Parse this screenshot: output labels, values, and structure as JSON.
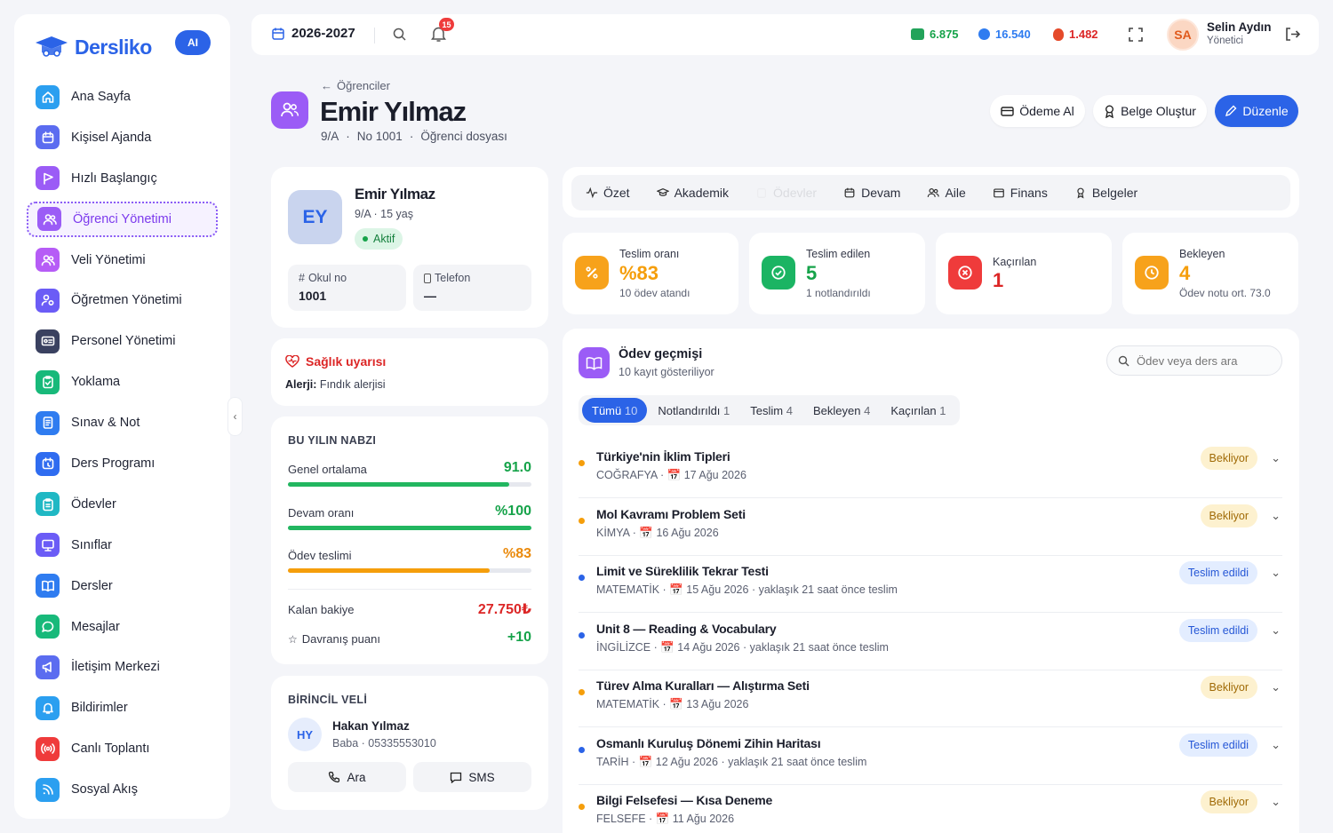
{
  "sidebar": {
    "brand": "Dersliko",
    "ai_badge": "AI",
    "items": [
      {
        "label": "Ana Sayfa",
        "icon": "home-icon",
        "color": "#2b9ff0"
      },
      {
        "label": "Kişisel Ajanda",
        "icon": "calendar-icon",
        "color": "#5b6cf0"
      },
      {
        "label": "Hızlı Başlangıç",
        "icon": "flag-icon",
        "color": "#9b5cf6"
      },
      {
        "label": "Öğrenci Yönetimi",
        "icon": "users-icon",
        "color": "#9b5cf6"
      },
      {
        "label": "Veli Yönetimi",
        "icon": "users-icon",
        "color": "#b65cf6"
      },
      {
        "label": "Öğretmen Yönetimi",
        "icon": "user-gear-icon",
        "color": "#6b5cf6"
      },
      {
        "label": "Personel Yönetimi",
        "icon": "id-card-icon",
        "color": "#3a4160"
      },
      {
        "label": "Yoklama",
        "icon": "clipboard-check-icon",
        "color": "#18b97a"
      },
      {
        "label": "Sınav & Not",
        "icon": "document-icon",
        "color": "#2f7cf0"
      },
      {
        "label": "Ders Programı",
        "icon": "calendar-clock-icon",
        "color": "#2f6cf0"
      },
      {
        "label": "Ödevler",
        "icon": "clipboard-icon",
        "color": "#20b8c4"
      },
      {
        "label": "Sınıflar",
        "icon": "monitor-icon",
        "color": "#6b5cf6"
      },
      {
        "label": "Dersler",
        "icon": "book-icon",
        "color": "#2f7cf0"
      },
      {
        "label": "Mesajlar",
        "icon": "chat-icon",
        "color": "#18b97a"
      },
      {
        "label": "İletişim Merkezi",
        "icon": "megaphone-icon",
        "color": "#5b6cf0"
      },
      {
        "label": "Bildirimler",
        "icon": "bell-icon",
        "color": "#2b9ff0"
      },
      {
        "label": "Canlı Toplantı",
        "icon": "broadcast-icon",
        "color": "#ef3b3b"
      },
      {
        "label": "Sosyal Akış",
        "icon": "rss-icon",
        "color": "#2b9ff0"
      }
    ]
  },
  "topbar": {
    "year": "2026-2027",
    "notif_count": "15",
    "stat_green": "6.875",
    "stat_blue": "16.540",
    "stat_red": "1.482",
    "user_initials": "SA",
    "user_name": "Selin Aydın",
    "user_role": "Yönetici"
  },
  "header": {
    "back": "Öğrenciler",
    "title": "Emir Yılmaz",
    "class": "9/A",
    "number": "No 1001",
    "file": "Öğrenci dosyası",
    "btn_payment": "Ödeme Al",
    "btn_doc": "Belge Oluştur",
    "btn_edit": "Düzenle"
  },
  "profile": {
    "initials": "EY",
    "name": "Emir Yılmaz",
    "meta": "9/A · 15 yaş",
    "status": "Aktif",
    "school_no_label": "Okul no",
    "school_no": "1001",
    "phone_label": "Telefon",
    "phone": "—"
  },
  "health": {
    "title": "Sağlık uyarısı",
    "label": "Alerji:",
    "value": "Fındık alerjisi"
  },
  "pulse": {
    "title": "BU YILIN NABZI",
    "avg_label": "Genel ortalama",
    "avg_value": "91.0",
    "avg_pct": 91,
    "att_label": "Devam oranı",
    "att_value": "%100",
    "att_pct": 100,
    "hw_label": "Ödev teslimi",
    "hw_value": "%83",
    "hw_pct": 83,
    "balance_label": "Kalan bakiye",
    "balance_value": "27.750₺",
    "behavior_label": "Davranış puanı",
    "behavior_value": "+10"
  },
  "parent": {
    "title": "BİRİNCİL VELİ",
    "initials": "HY",
    "name": "Hakan Yılmaz",
    "meta": "Baba · 05335553010",
    "call": "Ara",
    "sms": "SMS"
  },
  "tabs": [
    {
      "label": "Özet",
      "icon": "activity-icon"
    },
    {
      "label": "Akademik",
      "icon": "graduation-icon"
    },
    {
      "label": "Ödevler",
      "icon": "clipboard-icon",
      "faded": true
    },
    {
      "label": "Devam",
      "icon": "calendar-icon"
    },
    {
      "label": "Aile",
      "icon": "users-icon"
    },
    {
      "label": "Finans",
      "icon": "wallet-icon"
    },
    {
      "label": "Belgeler",
      "icon": "award-icon"
    }
  ],
  "kpis": [
    {
      "label": "Teslim oranı",
      "value": "%83",
      "sub": "10 ödev atandı",
      "color": "#f59e0b"
    },
    {
      "label": "Teslim edilen",
      "value": "5",
      "sub": "1 notlandırıldı",
      "color": "#16a34a"
    },
    {
      "label": "Kaçırılan",
      "value": "1",
      "sub": "",
      "color": "#dc2626"
    },
    {
      "label": "Bekleyen",
      "value": "4",
      "sub": "Ödev notu ort. 73.0",
      "color": "#f59e0b"
    }
  ],
  "history": {
    "title": "Ödev geçmişi",
    "subtitle": "10 kayıt gösteriliyor",
    "search_placeholder": "Ödev veya ders ara",
    "filters": [
      {
        "label": "Tümü",
        "count": "10"
      },
      {
        "label": "Notlandırıldı",
        "count": "1"
      },
      {
        "label": "Teslim",
        "count": "4"
      },
      {
        "label": "Bekleyen",
        "count": "4"
      },
      {
        "label": "Kaçırılan",
        "count": "1"
      }
    ],
    "rows": [
      {
        "title": "Türkiye'nin İklim Tipleri",
        "subject": "COĞRAFYA",
        "date": "17 Ağu 2026",
        "extra": "",
        "status": "Bekliyor",
        "kind": "bekliyor"
      },
      {
        "title": "Mol Kavramı Problem Seti",
        "subject": "KİMYA",
        "date": "16 Ağu 2026",
        "extra": "",
        "status": "Bekliyor",
        "kind": "bekliyor"
      },
      {
        "title": "Limit ve Süreklilik Tekrar Testi",
        "subject": "MATEMATİK",
        "date": "15 Ağu 2026",
        "extra": "yaklaşık 21 saat önce teslim",
        "status": "Teslim edildi",
        "kind": "teslim"
      },
      {
        "title": "Unit 8 — Reading & Vocabulary",
        "subject": "İNGİLİZCE",
        "date": "14 Ağu 2026",
        "extra": "yaklaşık 21 saat önce teslim",
        "status": "Teslim edildi",
        "kind": "teslim"
      },
      {
        "title": "Türev Alma Kuralları — Alıştırma Seti",
        "subject": "MATEMATİK",
        "date": "13 Ağu 2026",
        "extra": "",
        "status": "Bekliyor",
        "kind": "bekliyor"
      },
      {
        "title": "Osmanlı Kuruluş Dönemi Zihin Haritası",
        "subject": "TARİH",
        "date": "12 Ağu 2026",
        "extra": "yaklaşık 21 saat önce teslim",
        "status": "Teslim edildi",
        "kind": "teslim"
      },
      {
        "title": "Bilgi Felsefesi — Kısa Deneme",
        "subject": "FELSEFE",
        "date": "11 Ağu 2026",
        "extra": "",
        "status": "Bekliyor",
        "kind": "bekliyor"
      }
    ]
  }
}
